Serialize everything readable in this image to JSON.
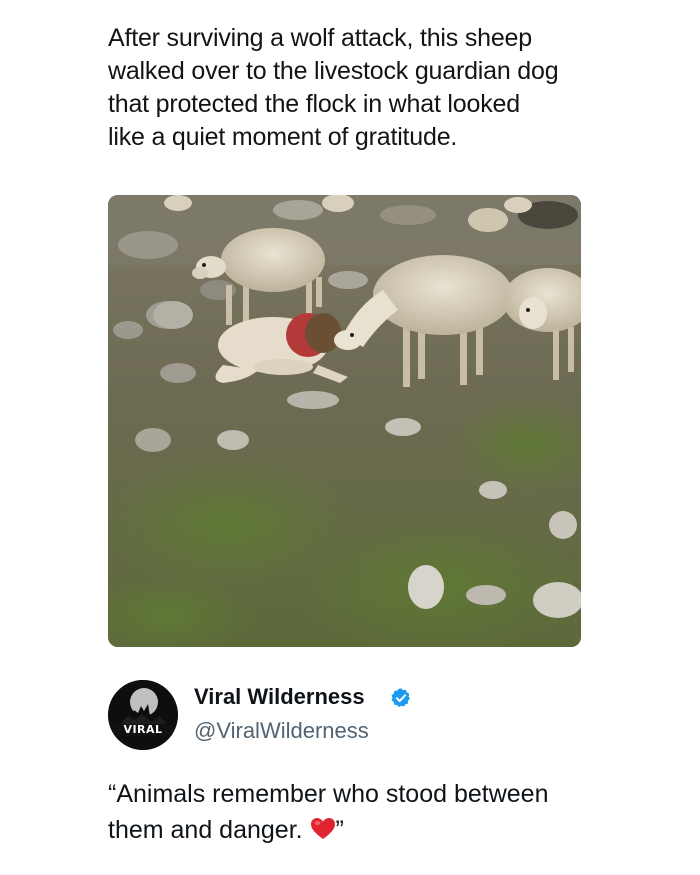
{
  "caption": {
    "lines": [
      "After surviving a wolf attack, this sheep",
      "walked over to the livestock guardian dog",
      "that protected the flock in what looked",
      "like a quiet moment of gratitude."
    ]
  },
  "photo": {
    "subject": "sheep-and-guardian-dog"
  },
  "author": {
    "display_name": "Viral Wilderness",
    "handle": "@ViralWilderness",
    "verified": true,
    "avatar_text": "VIRAL",
    "verified_color": "#1d9bf0"
  },
  "tweet": {
    "line1": "“Animals remember who stood between",
    "line2_before": "them and danger. ",
    "line2_after": "”",
    "emoji": "red-heart"
  }
}
